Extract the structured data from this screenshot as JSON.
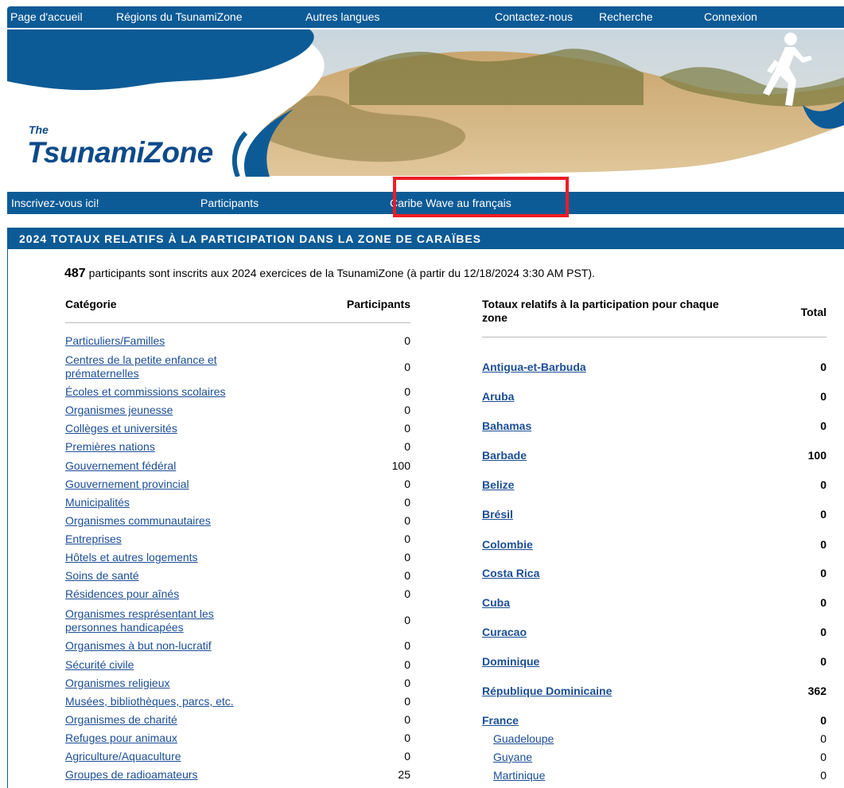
{
  "top_nav": [
    "Page d'accueil",
    "Régions du TsunamiZone",
    "Autres langues",
    "Contactez-nous",
    "Recherche",
    "Connexion"
  ],
  "logo": {
    "small": "The",
    "big": "TsunamiZone"
  },
  "sub_nav": [
    "Inscrivez-vous ici!",
    "Participants",
    "Caribe Wave au français"
  ],
  "panel_title": "2024 TOTAUX RELATIFS À LA PARTICIPATION DANS LA ZONE DE CARAÏBES",
  "intro": {
    "count": "487",
    "text": " participants sont inscrits aux 2024 exercices de la TsunamiZone (à partir du 12/18/2024 3:30 AM PST)."
  },
  "left_table": {
    "col_category": "Catégorie",
    "col_participants": "Participants",
    "rows": [
      {
        "label": "Particuliers/Familles",
        "value": "0"
      },
      {
        "label": "Centres de la petite enfance et prématernelles",
        "value": "0"
      },
      {
        "label": "Écoles et commissions scolaires",
        "value": "0"
      },
      {
        "label": "Organismes jeunesse",
        "value": "0"
      },
      {
        "label": "Collèges et universités",
        "value": "0"
      },
      {
        "label": "Premières nations",
        "value": "0"
      },
      {
        "label": "Gouvernement fédéral",
        "value": "100"
      },
      {
        "label": "Gouvernement provincial",
        "value": "0"
      },
      {
        "label": "Municipalités",
        "value": "0"
      },
      {
        "label": "Organismes communautaires",
        "value": "0"
      },
      {
        "label": "Entreprises",
        "value": "0"
      },
      {
        "label": "Hôtels et autres logements",
        "value": "0"
      },
      {
        "label": "Soins de santé",
        "value": "0"
      },
      {
        "label": "Résidences pour aînés",
        "value": "0"
      },
      {
        "label": "Organismes resprésentant les personnes handicapées",
        "value": "0"
      },
      {
        "label": "Organismes à but non-lucratif",
        "value": "0"
      },
      {
        "label": "Sécurité civile",
        "value": "0"
      },
      {
        "label": "Organismes religieux",
        "value": "0"
      },
      {
        "label": "Musées, bibliothèques, parcs, etc.",
        "value": "0"
      },
      {
        "label": "Organismes de charité",
        "value": "0"
      },
      {
        "label": "Refuges pour animaux",
        "value": "0"
      },
      {
        "label": "Agriculture/Aquaculture",
        "value": "0"
      },
      {
        "label": "Groupes de radioamateurs",
        "value": "25"
      }
    ]
  },
  "right_table": {
    "col_zone": "Totaux relatifs à la participation pour chaque zone",
    "col_total": "Total",
    "rows": [
      {
        "label": "Antigua-et-Barbuda",
        "value": "0"
      },
      {
        "label": "Aruba",
        "value": "0"
      },
      {
        "label": "Bahamas",
        "value": "0"
      },
      {
        "label": "Barbade",
        "value": "100"
      },
      {
        "label": "Belize",
        "value": "0"
      },
      {
        "label": "Brésil",
        "value": "0"
      },
      {
        "label": "Colombie",
        "value": "0"
      },
      {
        "label": "Costa Rica",
        "value": "0"
      },
      {
        "label": "Cuba",
        "value": "0"
      },
      {
        "label": "Curacao",
        "value": "0"
      },
      {
        "label": "Dominique",
        "value": "0"
      },
      {
        "label": "République Dominicaine",
        "value": "362"
      },
      {
        "label": "France",
        "value": "0"
      },
      {
        "label": "Guadeloupe",
        "value": "0"
      },
      {
        "label": "Guyane",
        "value": "0"
      },
      {
        "label": "Martinique",
        "value": "0"
      }
    ]
  }
}
